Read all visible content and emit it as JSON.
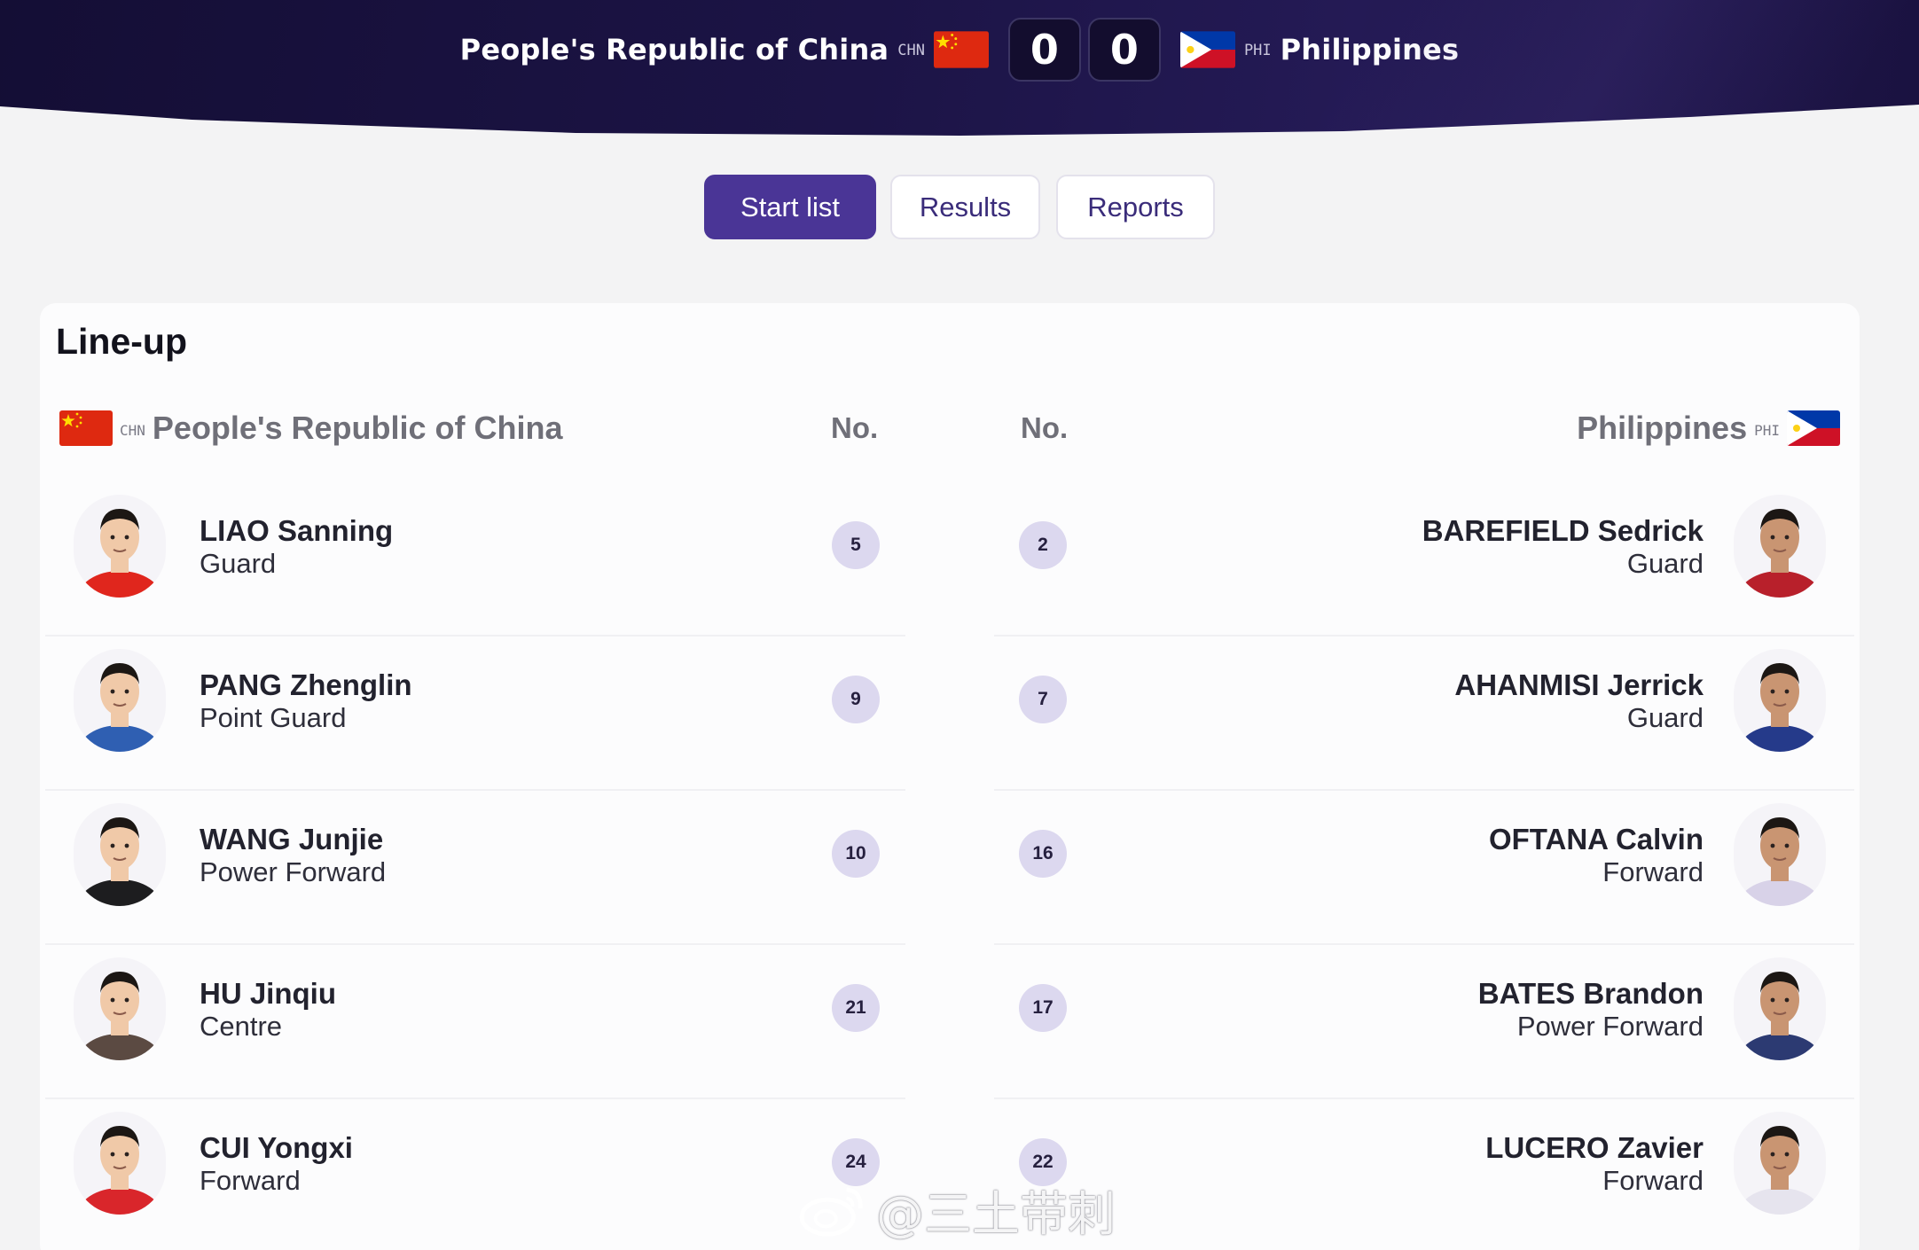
{
  "header": {
    "left_team": {
      "name": "People's Republic of China",
      "code": "CHN",
      "flag": "china-flag"
    },
    "right_team": {
      "name": "Philippines",
      "code": "PHI",
      "flag": "philippines-flag"
    },
    "left_score": "0",
    "right_score": "0"
  },
  "tabs": [
    {
      "label": "Start list",
      "active": true
    },
    {
      "label": "Results",
      "active": false
    },
    {
      "label": "Reports",
      "active": false
    }
  ],
  "lineup": {
    "title": "Line-up",
    "left_team": {
      "code": "CHN",
      "name": "People's Republic of China"
    },
    "right_team": {
      "code": "PHI",
      "name": "Philippines"
    },
    "no_label_left": "No.",
    "no_label_right": "No.",
    "left_players": [
      {
        "name": "LIAO Sanning",
        "position": "Guard",
        "number": "5",
        "jersey": "#e0261d"
      },
      {
        "name": "PANG Zhenglin",
        "position": "Point Guard",
        "number": "9",
        "jersey": "#2f5fb2"
      },
      {
        "name": "WANG Junjie",
        "position": "Power Forward",
        "number": "10",
        "jersey": "#1d1d1f"
      },
      {
        "name": "HU Jinqiu",
        "position": "Centre",
        "number": "21",
        "jersey": "#5b4a42"
      },
      {
        "name": "CUI Yongxi",
        "position": "Forward",
        "number": "24",
        "jersey": "#d9262b"
      }
    ],
    "right_players": [
      {
        "name": "BAREFIELD Sedrick",
        "position": "Guard",
        "number": "2",
        "jersey": "#b8202b"
      },
      {
        "name": "AHANMISI Jerrick",
        "position": "Guard",
        "number": "7",
        "jersey": "#253a8a"
      },
      {
        "name": "OFTANA Calvin",
        "position": "Forward",
        "number": "16",
        "jersey": "#d8d2e8"
      },
      {
        "name": "BATES Brandon",
        "position": "Power Forward",
        "number": "17",
        "jersey": "#2c3a72"
      },
      {
        "name": "LUCERO Zavier",
        "position": "Forward",
        "number": "22",
        "jersey": "#e6e4ee"
      }
    ]
  },
  "watermark": {
    "text": "@三土带刺"
  },
  "colors": {
    "accent": "#4a3596",
    "header_bg": "#1a1240",
    "number_badge": "#dcd8ef"
  }
}
